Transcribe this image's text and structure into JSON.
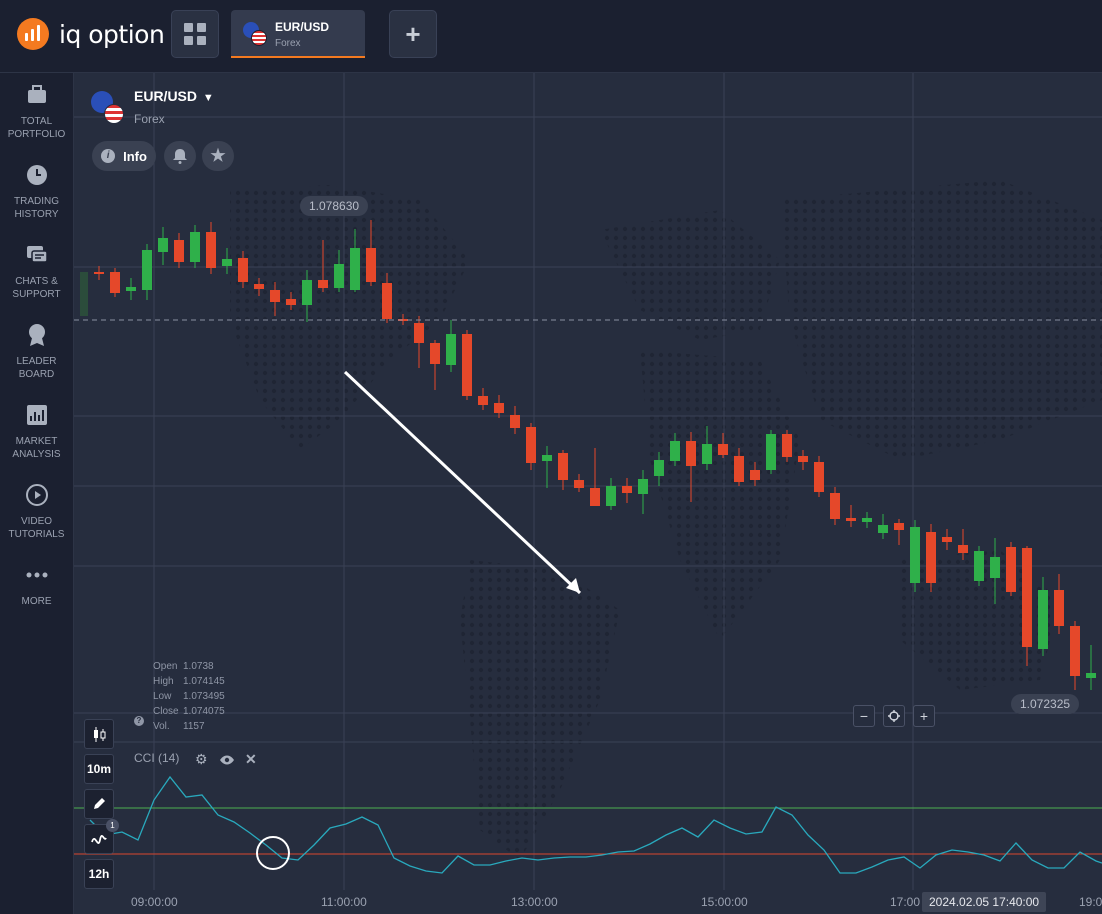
{
  "header": {
    "logo_text": "iq option",
    "active_tab": {
      "symbol": "EUR/USD",
      "category": "Forex"
    },
    "apps_icon": "grid-icon",
    "add_icon": "plus-icon",
    "accent_color": "#f47a20"
  },
  "sidebar": {
    "items": [
      {
        "line1": "TOTAL",
        "line2": "PORTFOLIO",
        "icon": "briefcase-icon"
      },
      {
        "line1": "TRADING",
        "line2": "HISTORY",
        "icon": "clock-icon"
      },
      {
        "line1": "CHATS &",
        "line2": "SUPPORT",
        "icon": "chat-icon"
      },
      {
        "line1": "LEADER",
        "line2": "BOARD",
        "icon": "medal-icon"
      },
      {
        "line1": "MARKET",
        "line2": "ANALYSIS",
        "icon": "chart-icon"
      },
      {
        "line1": "VIDEO",
        "line2": "TUTORIALS",
        "icon": "play-icon"
      },
      {
        "line1": "MORE",
        "line2": "",
        "icon": "dots-icon"
      }
    ]
  },
  "asset": {
    "symbol": "EUR/USD",
    "category": "Forex",
    "info_label": "Info",
    "bell_icon": "bell-icon",
    "star_icon": "star-icon"
  },
  "chart": {
    "high_label": "1.078630",
    "current_label": "1.072325",
    "ohlc": {
      "open_label": "Open",
      "open": "1.0738",
      "high_label": "High",
      "high": "1.074145",
      "low_label": "Low",
      "low": "1.073495",
      "close_label": "Close",
      "close": "1.074075",
      "vol_label": "Vol.",
      "vol": "1157"
    },
    "indicator": "CCI (14)",
    "toolbar": {
      "timeframe": "10m",
      "period": "12h",
      "badge": "1"
    },
    "time_labels": [
      "09:00:00",
      "11:00:00",
      "13:00:00",
      "15:00:00",
      "17:00",
      "19:0"
    ],
    "cursor_time": "2024.02.05 17:40:00",
    "colors": {
      "up": "#2fb04a",
      "down": "#e5482a",
      "cci": "#29a9bd",
      "upper": "#4caf50",
      "lower": "#d9462e"
    }
  }
}
